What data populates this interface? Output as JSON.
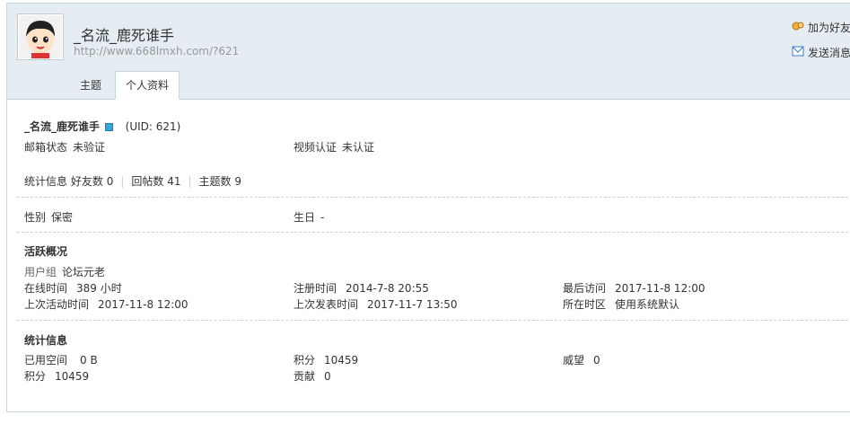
{
  "profile": {
    "username": "_名流_鹿死谁手",
    "url": "http://www.668lmxh.com/?621",
    "uid_text": "(UID: 621)"
  },
  "actions": [
    {
      "label": "加为好友",
      "icon": "add-friend-icon"
    },
    {
      "label": "发送消息",
      "icon": "envelope-icon"
    }
  ],
  "tabs": [
    {
      "label": "主题"
    },
    {
      "label": "个人资料"
    }
  ],
  "basic": {
    "email_status_label": "邮箱状态",
    "email_status_value": "未验证",
    "video_label": "视频认证",
    "video_value": "未认证",
    "stats_label": "统计信息",
    "friends_label": "好友数",
    "friends_value": "0",
    "replies_label": "回帖数",
    "replies_value": "41",
    "threads_label": "主题数",
    "threads_value": "9",
    "gender_label": "性别",
    "gender_value": "保密",
    "birthday_label": "生日",
    "birthday_value": "-"
  },
  "activity": {
    "title": "活跃概况",
    "group_label": "用户组",
    "group_value": "论坛元老",
    "online_label": "在线时间",
    "online_value": "389 小时",
    "register_label": "注册时间",
    "register_value": "2014-7-8 20:55",
    "last_visit_label": "最后访问",
    "last_visit_value": "2017-11-8 12:00",
    "last_active_label": "上次活动时间",
    "last_active_value": "2017-11-8 12:00",
    "last_post_label": "上次发表时间",
    "last_post_value": "2017-11-7 13:50",
    "timezone_label": "所在时区",
    "timezone_value": "使用系统默认"
  },
  "stats": {
    "title": "统计信息",
    "space_label": "已用空间",
    "space_value": "0 B",
    "points_label": "积分",
    "points_value": "10459",
    "prestige_label": "威望",
    "prestige_value": "0",
    "points2_label": "积分",
    "points2_value": "10459",
    "contrib_label": "贡献",
    "contrib_value": "0"
  }
}
